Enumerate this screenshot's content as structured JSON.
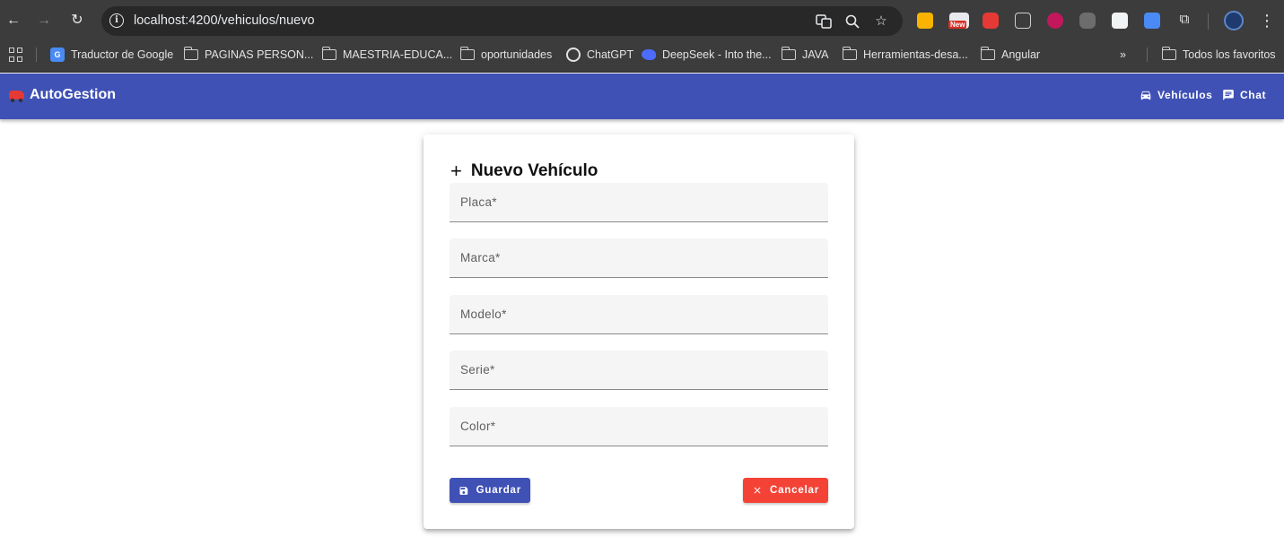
{
  "browser": {
    "url": "localhost:4200/vehiculos/nuevo",
    "bookmarks": [
      {
        "label": "Traductor de Google",
        "icon": "google-translate-icon"
      },
      {
        "label": "PAGINAS PERSON...",
        "icon": "folder-icon"
      },
      {
        "label": "MAESTRIA-EDUCA...",
        "icon": "folder-icon"
      },
      {
        "label": "oportunidades",
        "icon": "folder-icon"
      },
      {
        "label": "ChatGPT",
        "icon": "chatgpt-icon"
      },
      {
        "label": "DeepSeek - Into the...",
        "icon": "deepseek-icon"
      },
      {
        "label": "JAVA",
        "icon": "folder-icon"
      },
      {
        "label": "Herramientas-desa...",
        "icon": "folder-icon"
      },
      {
        "label": "Angular",
        "icon": "folder-icon"
      }
    ],
    "all_bookmarks": "Todos los favoritos",
    "new_badge": "New"
  },
  "app": {
    "brand": "AutoGestion",
    "nav": {
      "vehiculos": "Vehículos",
      "chat": "Chat"
    },
    "primary_color": "#3f51b5",
    "warn_color": "#f44336"
  },
  "form": {
    "title": "Nuevo Vehículo",
    "fields": {
      "placa": {
        "placeholder": "Placa*",
        "value": ""
      },
      "marca": {
        "placeholder": "Marca*",
        "value": ""
      },
      "modelo": {
        "placeholder": "Modelo*",
        "value": ""
      },
      "serie": {
        "placeholder": "Serie*",
        "value": ""
      },
      "color": {
        "placeholder": "Color*",
        "value": ""
      }
    },
    "save_label": "Guardar",
    "cancel_label": "Cancelar"
  }
}
